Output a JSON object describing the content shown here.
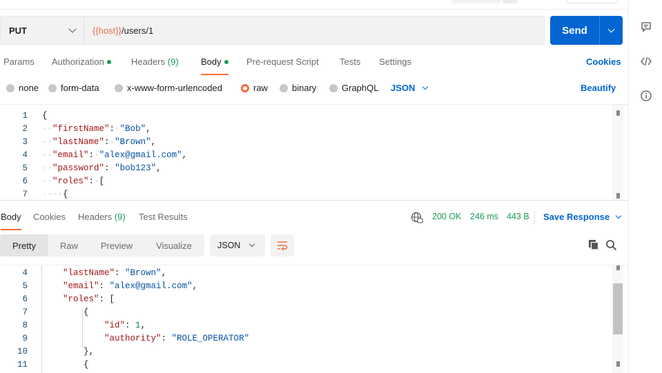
{
  "request": {
    "method": "PUT",
    "url_var": "{{host}}",
    "url_path": "/users/1",
    "send_label": "Send"
  },
  "request_tabs": {
    "params": "Params",
    "authorization": "Authorization",
    "headers": "Headers",
    "headers_count": "(9)",
    "body": "Body",
    "prerequest": "Pre-request Script",
    "tests": "Tests",
    "settings": "Settings",
    "cookies": "Cookies",
    "active": "Body"
  },
  "body_types": {
    "none": "none",
    "form_data": "form-data",
    "urlencoded": "x-www-form-urlencoded",
    "raw": "raw",
    "binary": "binary",
    "graphql": "GraphQL",
    "selected": "raw",
    "language": "JSON",
    "beautify": "Beautify"
  },
  "request_body": {
    "lines": [
      {
        "n": "1",
        "indent": "",
        "key": "",
        "val": "",
        "text": "{"
      },
      {
        "n": "2",
        "indent": "··",
        "key": "\"firstName\"",
        "val": "\"Bob\"",
        "text": ","
      },
      {
        "n": "3",
        "indent": "··",
        "key": "\"lastName\"",
        "val": "\"Brown\"",
        "text": ","
      },
      {
        "n": "4",
        "indent": "··",
        "key": "\"email\"",
        "val": "\"alex@gmail.com\"",
        "text": ","
      },
      {
        "n": "5",
        "indent": "··",
        "key": "\"password\"",
        "val": "\"bob123\"",
        "text": ","
      },
      {
        "n": "6",
        "indent": "··",
        "key": "\"roles\"",
        "val": "",
        "text": "["
      },
      {
        "n": "7",
        "indent": "····",
        "key": "",
        "val": "",
        "text": "{"
      }
    ]
  },
  "response_tabs": {
    "body": "Body",
    "cookies": "Cookies",
    "headers": "Headers",
    "headers_count": "(9)",
    "test_results": "Test Results"
  },
  "response_status": {
    "status": "200 OK",
    "time": "246 ms",
    "size": "443 B",
    "save_response": "Save Response"
  },
  "response_view": {
    "pretty": "Pretty",
    "raw": "Raw",
    "preview": "Preview",
    "visualize": "Visualize",
    "active": "Pretty",
    "format": "JSON"
  },
  "response_body": {
    "lines": [
      {
        "n": "4",
        "key": "\"lastName\"",
        "val": "\"Brown\"",
        "num": "",
        "text": ","
      },
      {
        "n": "5",
        "key": "\"email\"",
        "val": "\"alex@gmail.com\"",
        "num": "",
        "text": ","
      },
      {
        "n": "6",
        "key": "\"roles\"",
        "val": "",
        "num": "",
        "text": "["
      },
      {
        "n": "7",
        "key": "",
        "val": "",
        "num": "",
        "text": "{"
      },
      {
        "n": "8",
        "key": "\"id\"",
        "val": "",
        "num": "1",
        "text": ","
      },
      {
        "n": "9",
        "key": "\"authority\"",
        "val": "\"ROLE_OPERATOR\"",
        "num": "",
        "text": ""
      },
      {
        "n": "10",
        "key": "",
        "val": "",
        "num": "",
        "text": "},"
      },
      {
        "n": "11",
        "key": "",
        "val": "",
        "num": "",
        "text": "{"
      }
    ]
  },
  "colors": {
    "accent": "#ff6c37",
    "primary": "#0265d2",
    "success": "#1a9b5a",
    "variable": "#e96e4c"
  }
}
